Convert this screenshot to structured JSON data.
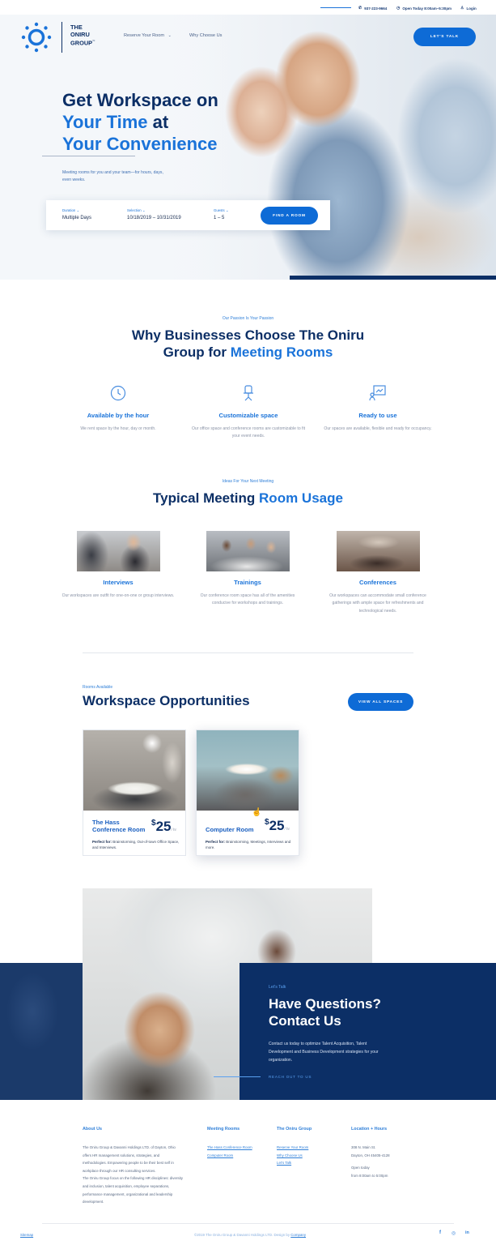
{
  "topbar": {
    "phone": "937-223-9664",
    "hours": "Open Today 8:00am–5:30pm",
    "login": "Login"
  },
  "brand": {
    "line1": "THE",
    "line2": "ONIRU",
    "line3": "GROUP",
    "tm": "™"
  },
  "nav": {
    "reserve": "Reserve Your Room",
    "why": "Why Choose Us",
    "cta": "LET'S TALK"
  },
  "hero": {
    "title_a": "Get Workspace on",
    "title_b": "Your Time",
    "title_c": " at",
    "title_d": "Your Convenience",
    "subtitle": "Meeting rooms for you and your team—for hours, days, even weeks.",
    "search": {
      "duration_label": "Duration",
      "duration_value": "Multiple Days",
      "selection_label": "Selection",
      "selection_value": "10/18/2019 – 10/31/2019",
      "guests_label": "Guests",
      "guests_value": "1 – 5",
      "button": "FIND A ROOM"
    }
  },
  "why": {
    "eyebrow": "Our Passion Is Your Passion",
    "title_a": "Why Businesses Choose The Oniru",
    "title_b": "Group for ",
    "title_c": "Meeting Rooms",
    "features": [
      {
        "title": "Available by the hour",
        "desc": "We rent space by the hour, day or month.",
        "icon": "clock-icon"
      },
      {
        "title": "Customizable space",
        "desc": "Our office space and conference rooms are customizable to fit your event needs.",
        "icon": "chair-icon"
      },
      {
        "title": "Ready to use",
        "desc": "Our spaces are available, flexible and ready for occupancy.",
        "icon": "presentation-icon"
      }
    ]
  },
  "usage": {
    "eyebrow": "Ideas For Your Next Meeting",
    "title_a": "Typical Meeting ",
    "title_b": "Room Usage",
    "items": [
      {
        "title": "Interviews",
        "desc": "Our workspaces are outfit for one-on-one or group interviews."
      },
      {
        "title": "Trainings",
        "desc": "Our conference room space has all of the amenities conducive for workshops and trainings."
      },
      {
        "title": "Conferences",
        "desc": "Our workspaces can accommodate small conference gatherings with ample space for refreshments and technological needs."
      }
    ]
  },
  "rooms": {
    "eyebrow": "Rooms Available",
    "title": "Workspace Opportunities",
    "view_all": "VIEW ALL SPACES",
    "cards": [
      {
        "name_a": "The Hass",
        "name_b": "Conference Room",
        "currency": "$",
        "price": "25",
        "unit": "/ hr",
        "perfect_label": "Perfect for:",
        "perfect": " Brainstorming, Out-of-town Office Space, and Interviews."
      },
      {
        "name_a": "Computer Room",
        "name_b": "",
        "currency": "$",
        "price": "25",
        "unit": "/ hr",
        "perfect_label": "Perfect for:",
        "perfect": " Brainstorming, Meetings, Interviews and more."
      }
    ]
  },
  "contact": {
    "eyebrow": "Let's Talk",
    "title_a": "Have Questions?",
    "title_b": "Contact Us",
    "desc": "Contact us today to optimize Talent Acquisition, Talent Development and Business Development strategies for your organization.",
    "link": "REACH OUT TO US"
  },
  "footer": {
    "about_title": "About Us",
    "about_1": "The Oniru Group & Davanni Holdings LTD. of Dayton, Ohio offers HR management solutions, strategies, and methodologies. Empowering people to be their best self in workplace through our HR consulting services.",
    "about_2": "The Oniru Group focus on the following HR disciplines: diversity and inclusion, talent acquisition, employee separations, performance management, organizational and leadership development.",
    "rooms_title": "Meeting Rooms",
    "rooms_links": [
      "The Hass Conference Room",
      "Computer Room"
    ],
    "group_title": "The Oniru Group",
    "group_links": [
      "Reserve Your Room",
      "Why Choose Us",
      "Let's Talk"
    ],
    "loc_title": "Location + Hours",
    "address_1": "308 N. Main St.",
    "address_2": "Dayton, OH 45405-4128",
    "open_1": "Open today",
    "open_2": "from 8:00am to 5:00pm",
    "sitemap": "Sitemap",
    "copyright_a": "©2019 The Oniru Group & Davanni Holdings LTD. Design by ",
    "copyright_b": "Company",
    "social": [
      "f",
      "◎",
      "in"
    ]
  },
  "colors": {
    "navy": "#0c2f66",
    "blue": "#1a73d9",
    "button": "#0e6bd6"
  }
}
